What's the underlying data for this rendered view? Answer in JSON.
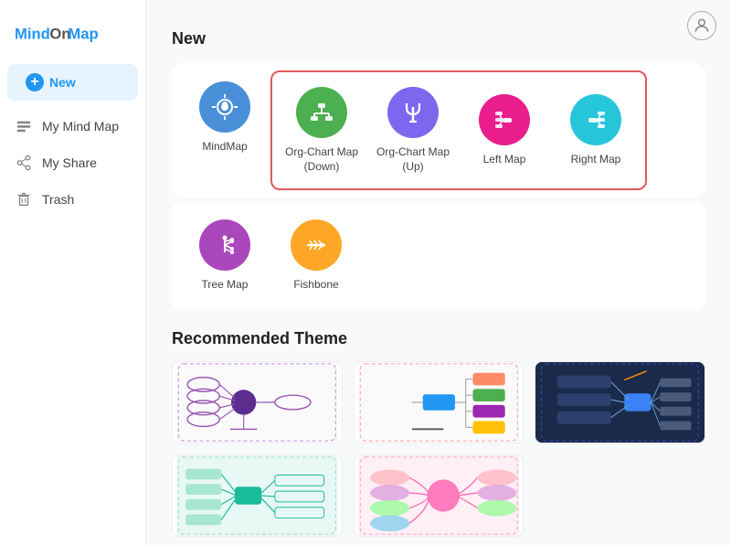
{
  "logo": {
    "part1": "MindOn",
    "part2": "Map"
  },
  "sidebar": {
    "new_label": "New",
    "items": [
      {
        "id": "new",
        "label": "New",
        "icon": "+"
      },
      {
        "id": "my-mind-map",
        "label": "My Mind Map",
        "icon": "🗂"
      },
      {
        "id": "my-share",
        "label": "My Share",
        "icon": "🔗"
      },
      {
        "id": "trash",
        "label": "Trash",
        "icon": "🗑"
      }
    ]
  },
  "main": {
    "new_section_title": "New",
    "map_types": [
      {
        "id": "mindmap",
        "label": "MindMap",
        "color": "#4A90D9",
        "icon": "💡"
      },
      {
        "id": "org-chart-down",
        "label": "Org-Chart Map\n(Down)",
        "color": "#4CAF50",
        "icon": "org-down"
      },
      {
        "id": "org-chart-up",
        "label": "Org-Chart Map (Up)",
        "color": "#7B68EE",
        "icon": "org-up"
      },
      {
        "id": "left-map",
        "label": "Left Map",
        "color": "#E91E8C",
        "icon": "left"
      },
      {
        "id": "right-map",
        "label": "Right Map",
        "color": "#26C6DA",
        "icon": "right"
      },
      {
        "id": "tree-map",
        "label": "Tree Map",
        "color": "#AB47BC",
        "icon": "tree"
      },
      {
        "id": "fishbone",
        "label": "Fishbone",
        "color": "#FFA726",
        "icon": "fishbone"
      }
    ],
    "recommended_title": "Recommended Theme",
    "themes": [
      {
        "id": "theme1",
        "type": "light-purple"
      },
      {
        "id": "theme2",
        "type": "colorful"
      },
      {
        "id": "theme3",
        "type": "dark-blue"
      },
      {
        "id": "theme4",
        "type": "light-teal"
      },
      {
        "id": "theme5",
        "type": "pastel"
      }
    ]
  },
  "colors": {
    "accent": "#2196F3",
    "sidebar_active_bg": "#E8F4FD",
    "red_border": "#e05a5a"
  }
}
